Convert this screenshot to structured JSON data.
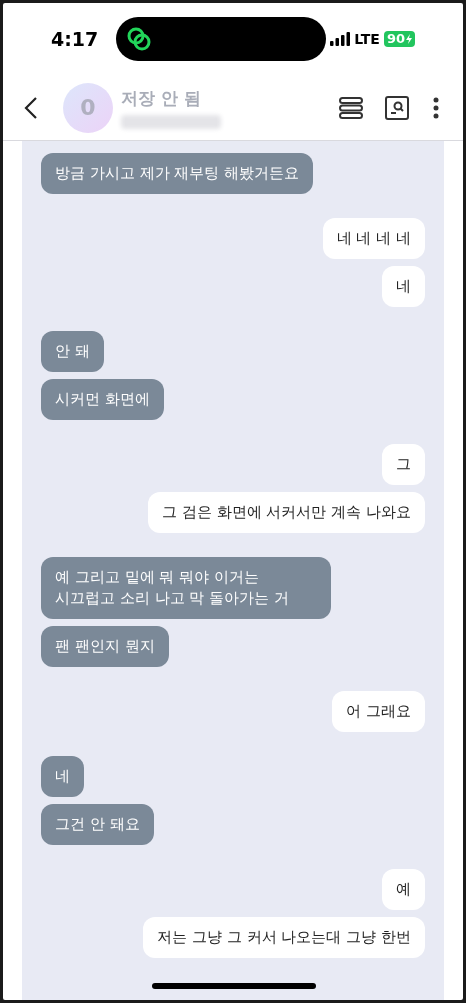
{
  "status_bar": {
    "time": "4:17",
    "network": "LTE",
    "battery": "90"
  },
  "header": {
    "avatar_letter": "0",
    "title": "저장 안 됨"
  },
  "groups": [
    {
      "kind": "received",
      "messages": [
        "방금 가시고 제가 재부팅 해봤거든요"
      ]
    },
    {
      "kind": "sent",
      "messages": [
        "네 네 네 네",
        "네"
      ]
    },
    {
      "kind": "received",
      "messages": [
        "안 돼",
        "시커먼 화면에"
      ]
    },
    {
      "kind": "sent",
      "messages": [
        "그",
        "그 검은 화면에 서커서만 계속 나와요"
      ]
    },
    {
      "kind": "received",
      "messages": [
        "예 그리고 밑에 뭐 뭐야 이거는 시끄럽고 소리 나고 막 돌아가는 거",
        "팬 팬인지 뭔지"
      ]
    },
    {
      "kind": "sent",
      "messages": [
        "어 그래요"
      ]
    },
    {
      "kind": "received",
      "messages": [
        "네",
        "그건 안 돼요"
      ]
    },
    {
      "kind": "sent",
      "messages": [
        "예",
        "저는 그냥 그 커서 나오는대 그냥 한번"
      ]
    }
  ]
}
